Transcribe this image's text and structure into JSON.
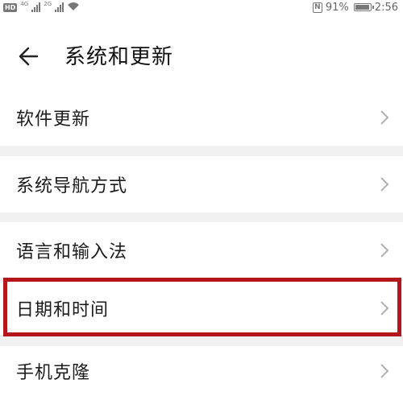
{
  "status_bar": {
    "hd_label": "HD",
    "network_tag_1": "4G",
    "network_tag_2": "2G",
    "nfc_label": "N",
    "battery": "91%",
    "time": "2:56"
  },
  "header": {
    "title": "系统和更新"
  },
  "items": [
    {
      "label": "软件更新"
    },
    {
      "label": "系统导航方式"
    },
    {
      "label": "语言和输入法"
    },
    {
      "label": "日期和时间"
    },
    {
      "label": "手机克隆"
    }
  ],
  "colors": {
    "highlight": "#b4161b",
    "background": "#f1f1f1",
    "row": "#ffffff"
  },
  "icons": {
    "back": "arrow-left-icon",
    "chevron": "chevron-right-icon"
  }
}
